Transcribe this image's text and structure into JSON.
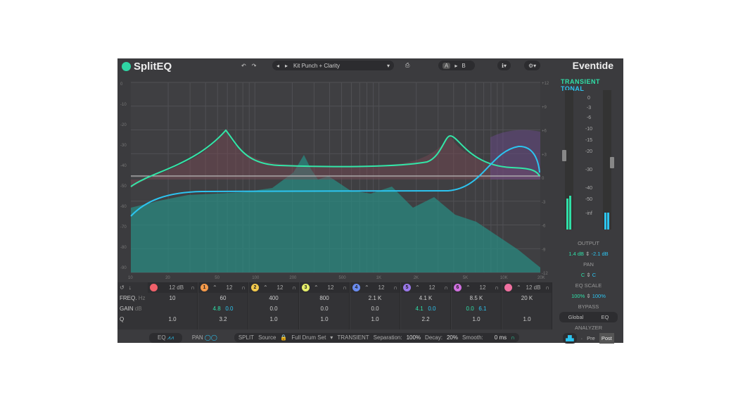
{
  "app": {
    "title": "SplitEQ",
    "brand": "Eventide"
  },
  "toolbar": {
    "preset": "Kit Punch + Clarity",
    "a": "A",
    "b": "B"
  },
  "modes": {
    "transient": "TRANSIENT",
    "tonal": "TONAL"
  },
  "graph": {
    "left_axis": [
      "0",
      "-10",
      "-20",
      "-30",
      "-40",
      "-50",
      "-60",
      "-70",
      "-80",
      "-90"
    ],
    "right_axis": [
      "+12",
      "+9",
      "+6",
      "+3",
      "0",
      "-3",
      "-6",
      "-9",
      "-12"
    ],
    "freq_axis": [
      "10",
      "20",
      "50",
      "100",
      "200",
      "500",
      "1K",
      "2K",
      "5K",
      "10K",
      "20K"
    ]
  },
  "rows": {
    "freq": "FREQ.",
    "freq_unit": "Hz",
    "gain": "GAIN",
    "gain_unit": "dB",
    "q": "Q"
  },
  "bands": [
    {
      "num": "",
      "color": "#f0606a",
      "shape": "12 dB",
      "freq": "10",
      "gain_t": "",
      "gain_s": "",
      "q": "1.0"
    },
    {
      "num": "1",
      "color": "#f59a4a",
      "shape": "12",
      "freq": "60",
      "gain_t": "4.8",
      "gain_s": "0.0",
      "q": "3.2"
    },
    {
      "num": "2",
      "color": "#f2c94c",
      "shape": "12",
      "freq": "400",
      "gain": "0.0",
      "q": "1.0"
    },
    {
      "num": "3",
      "color": "#e6ef6a",
      "shape": "12",
      "freq": "800",
      "gain": "0.0",
      "q": "1.0"
    },
    {
      "num": "4",
      "color": "#6a8cf0",
      "shape": "12",
      "freq": "2.1 K",
      "gain": "0.0",
      "q": "1.0"
    },
    {
      "num": "5",
      "color": "#9a78ea",
      "shape": "12",
      "freq": "4.1 K",
      "gain_t": "4.1",
      "gain_s": "0.0",
      "q": "2.2"
    },
    {
      "num": "6",
      "color": "#d070e0",
      "shape": "12",
      "freq": "8.5 K",
      "gain_t": "0.0",
      "gain_s": "6.1",
      "q": "1.0"
    },
    {
      "num": "",
      "color": "#f070a0",
      "shape": "12 dB",
      "freq": "20 K",
      "gain_t": "",
      "gain_s": "",
      "q": "1.0"
    }
  ],
  "bottom": {
    "eq": "EQ",
    "pan": "PAN",
    "split": "SPLIT",
    "source": "Source",
    "source_val": "Full Drum Set",
    "transient": "TRANSIENT",
    "separation": "Separation:",
    "separation_val": "100%",
    "decay": "Decay:",
    "decay_val": "20%",
    "smooth": "Smooth:",
    "smooth_val": "0 ms"
  },
  "meter": {
    "scale": [
      "0",
      "-3",
      "-6",
      "-10",
      "-15",
      "-20",
      "-30",
      "-40",
      "-50",
      "-inf"
    ],
    "transient_level": 0.22,
    "tonal_level": 0.12
  },
  "right": {
    "output": "OUTPUT",
    "out_t": "1.4 dB",
    "out_s": "-2.1 dB",
    "pan": "PAN",
    "pan_t": "C",
    "pan_s": "C",
    "eq_scale": "EQ SCALE",
    "scale_t": "100%",
    "scale_s": "100%",
    "bypass": "BYPASS",
    "global": "Global",
    "eq": "EQ",
    "analyzer": "ANALYZER",
    "pre": "Pre",
    "post": "Post"
  }
}
